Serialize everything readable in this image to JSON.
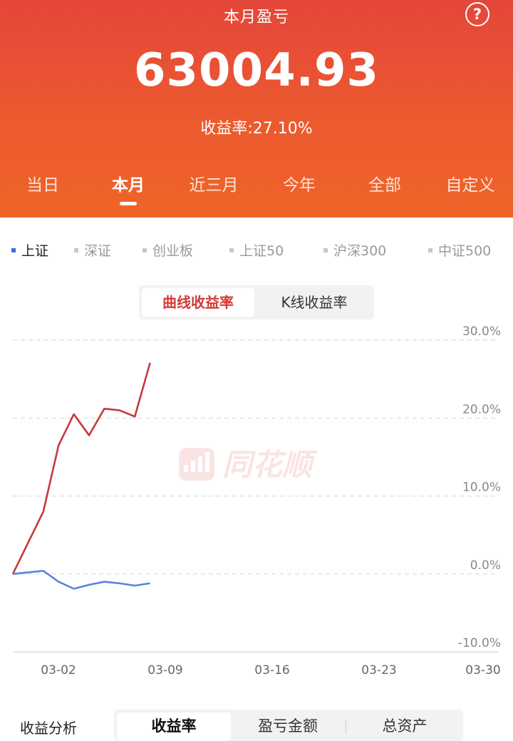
{
  "header": {
    "title": "本月盈亏",
    "help_icon": "?",
    "amount": "63004.93",
    "rate_text": "收益率:27.10%"
  },
  "period_tabs": [
    {
      "label": "当日",
      "active": false
    },
    {
      "label": "本月",
      "active": true
    },
    {
      "label": "近三月",
      "active": false
    },
    {
      "label": "今年",
      "active": false
    },
    {
      "label": "全部",
      "active": false
    },
    {
      "label": "自定义",
      "active": false
    }
  ],
  "index_legend": [
    {
      "label": "上证",
      "active": true
    },
    {
      "label": "深证",
      "active": false
    },
    {
      "label": "创业板",
      "active": false
    },
    {
      "label": "上证50",
      "active": false
    },
    {
      "label": "沪深300",
      "active": false
    },
    {
      "label": "中证500",
      "active": false
    }
  ],
  "chart_toggle": {
    "curve": "曲线收益率",
    "kline": "K线收益率",
    "active": "curve"
  },
  "watermark": "同花顺",
  "chart_data": {
    "type": "line",
    "x": [
      "03-01",
      "03-02",
      "03-03",
      "03-04",
      "03-05",
      "03-06",
      "03-07",
      "03-08",
      "03-09",
      "03-10"
    ],
    "x_ticks": [
      "03-02",
      "03-09",
      "03-16",
      "03-23",
      "03-30"
    ],
    "ylim": [
      -10,
      30
    ],
    "y_ticks": [
      "30.0%",
      "20.0%",
      "10.0%",
      "0.0%",
      "-10.0%"
    ],
    "series": [
      {
        "color": "#C8393A",
        "values": [
          0,
          4,
          8,
          16.5,
          20.5,
          17.8,
          21.2,
          21.0,
          20.2,
          27.1
        ]
      },
      {
        "color": "#5A85D8",
        "values": [
          0,
          0.2,
          0.4,
          -1,
          -1.9,
          -1.4,
          -1.0,
          -1.2,
          -1.5,
          -1.2
        ]
      }
    ],
    "grid": true
  },
  "bottom": {
    "label": "收益分析",
    "tabs": [
      {
        "label": "收益率",
        "active": true
      },
      {
        "label": "盈亏金额",
        "active": false
      },
      {
        "label": "总资产",
        "active": false
      }
    ]
  },
  "colors": {
    "header_top": "#E4463A",
    "header_bottom": "#F06428",
    "accent_red": "#D43A33",
    "index_blue": "#3B6FD8"
  }
}
